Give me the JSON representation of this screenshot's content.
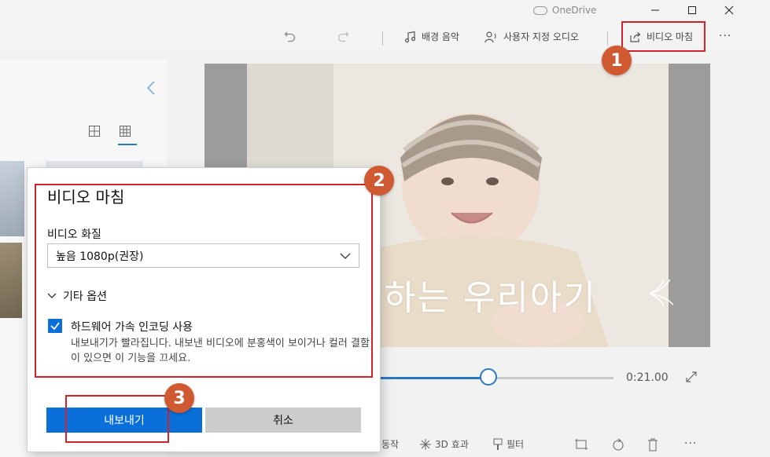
{
  "titlebar": {
    "onedrive_label": "OneDrive",
    "minimize_icon": "minimize-icon",
    "maximize_icon": "maximize-icon",
    "close_icon": "close-icon"
  },
  "toolbar": {
    "undo_icon": "undo-icon",
    "redo_icon": "redo-icon",
    "bg_music_label": "배경 음악",
    "custom_audio_label": "사용자 지정 오디오",
    "finish_video_label": "비디오 마침",
    "more_label": "···"
  },
  "player": {
    "overlay_text": "하는 우리아기",
    "time_label": "0:21.00",
    "progress_fraction": 0.47
  },
  "bottom_tools": {
    "motion_label": "동작",
    "effects_3d_label": "3D 효과",
    "filter_label": "필터",
    "more_label": "···"
  },
  "dialog": {
    "title": "비디오 마침",
    "quality_label": "비디오 화질",
    "quality_value": "높음 1080p(권장)",
    "more_options_label": "기타 옵션",
    "hw_encoding_label": "하드웨어 가속 인코딩 사용",
    "hw_encoding_desc": "내보내기가 빨라집니다. 내보낸 비디오에 분홍색이 보이거나 컬러 결함이 있으면 이 기능을 끄세요.",
    "hw_encoding_checked": true,
    "export_label": "내보내기",
    "cancel_label": "취소"
  },
  "annotations": {
    "badge1": "1",
    "badge2": "2",
    "badge3": "3"
  },
  "colors": {
    "accent": "#0a6fd8",
    "annotation_red": "#d0242b",
    "badge": "#cf5a32"
  }
}
